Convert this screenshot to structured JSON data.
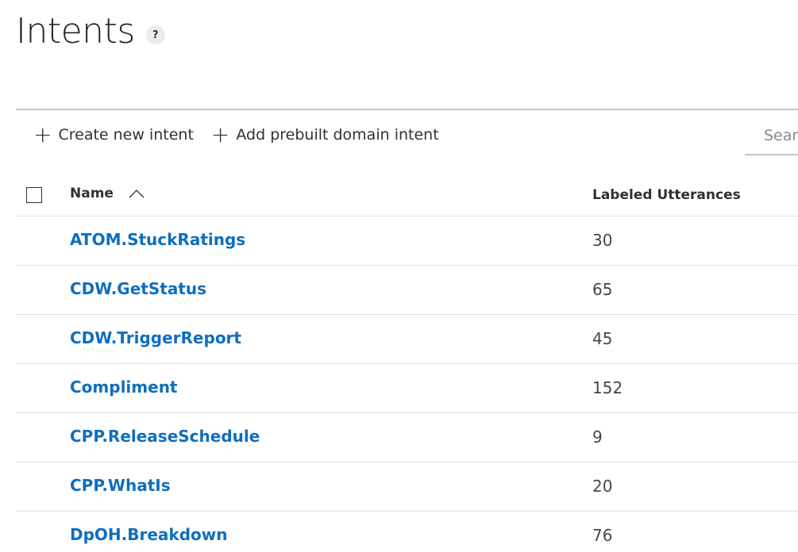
{
  "header": {
    "title": "Intents",
    "help_icon": "?"
  },
  "toolbar": {
    "create_label": "Create new intent",
    "prebuilt_label": "Add prebuilt domain intent",
    "search_placeholder": "Search"
  },
  "table": {
    "columns": {
      "name": "Name",
      "utterances": "Labeled Utterances"
    },
    "sort": "ascending",
    "rows": [
      {
        "name": "ATOM.StuckRatings",
        "count": "30"
      },
      {
        "name": "CDW.GetStatus",
        "count": "65"
      },
      {
        "name": "CDW.TriggerReport",
        "count": "45"
      },
      {
        "name": "Compliment",
        "count": "152"
      },
      {
        "name": "CPP.ReleaseSchedule",
        "count": "9"
      },
      {
        "name": "CPP.WhatIs",
        "count": "20"
      },
      {
        "name": "DpOH.Breakdown",
        "count": "76"
      }
    ]
  },
  "colors": {
    "link": "#106ebe",
    "divider": "#e1dfdd"
  }
}
